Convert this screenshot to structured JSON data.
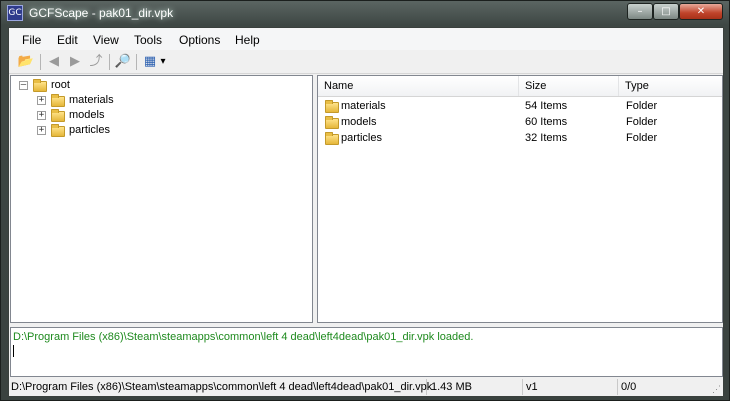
{
  "window": {
    "title": "GCFScape - pak01_dir.vpk",
    "app_icon_glyph": "GC",
    "buttons": {
      "minimize": "–",
      "maximize": "□",
      "close": "✕"
    }
  },
  "menu": [
    "File",
    "Edit",
    "View",
    "Tools",
    "Options",
    "Help"
  ],
  "toolbar": {
    "icons": [
      "open-folder-icon",
      "back-icon",
      "forward-icon",
      "up-icon",
      "search-icon",
      "view-mode-icon",
      "dropdown-arrow-icon"
    ],
    "glyphs": {
      "open": "📂",
      "back": "◀",
      "forward": "▶",
      "up": "⤴",
      "search": "🔎",
      "view": "▦",
      "dropdown": "▾"
    }
  },
  "tree": {
    "root": {
      "label": "root",
      "expander": "–"
    },
    "children": [
      {
        "label": "materials",
        "expander": "+"
      },
      {
        "label": "models",
        "expander": "+"
      },
      {
        "label": "particles",
        "expander": "+"
      }
    ]
  },
  "list": {
    "columns": [
      "Name",
      "Size",
      "Type"
    ],
    "rows": [
      {
        "name": "materials",
        "size": "54 Items",
        "type": "Folder"
      },
      {
        "name": "models",
        "size": "60 Items",
        "type": "Folder"
      },
      {
        "name": "particles",
        "size": "32 Items",
        "type": "Folder"
      }
    ]
  },
  "log": {
    "lines": [
      "D:\\Program Files (x86)\\Steam\\steamapps\\common\\left 4 dead\\left4dead\\pak01_dir.vpk loaded."
    ],
    "color": "#1e8a1e"
  },
  "status": {
    "path": "D:\\Program Files (x86)\\Steam\\steamapps\\common\\left 4 dead\\left4dead\\pak01_dir.vpk",
    "size": "1.43 MB",
    "version": "v1",
    "count": "0/0"
  }
}
